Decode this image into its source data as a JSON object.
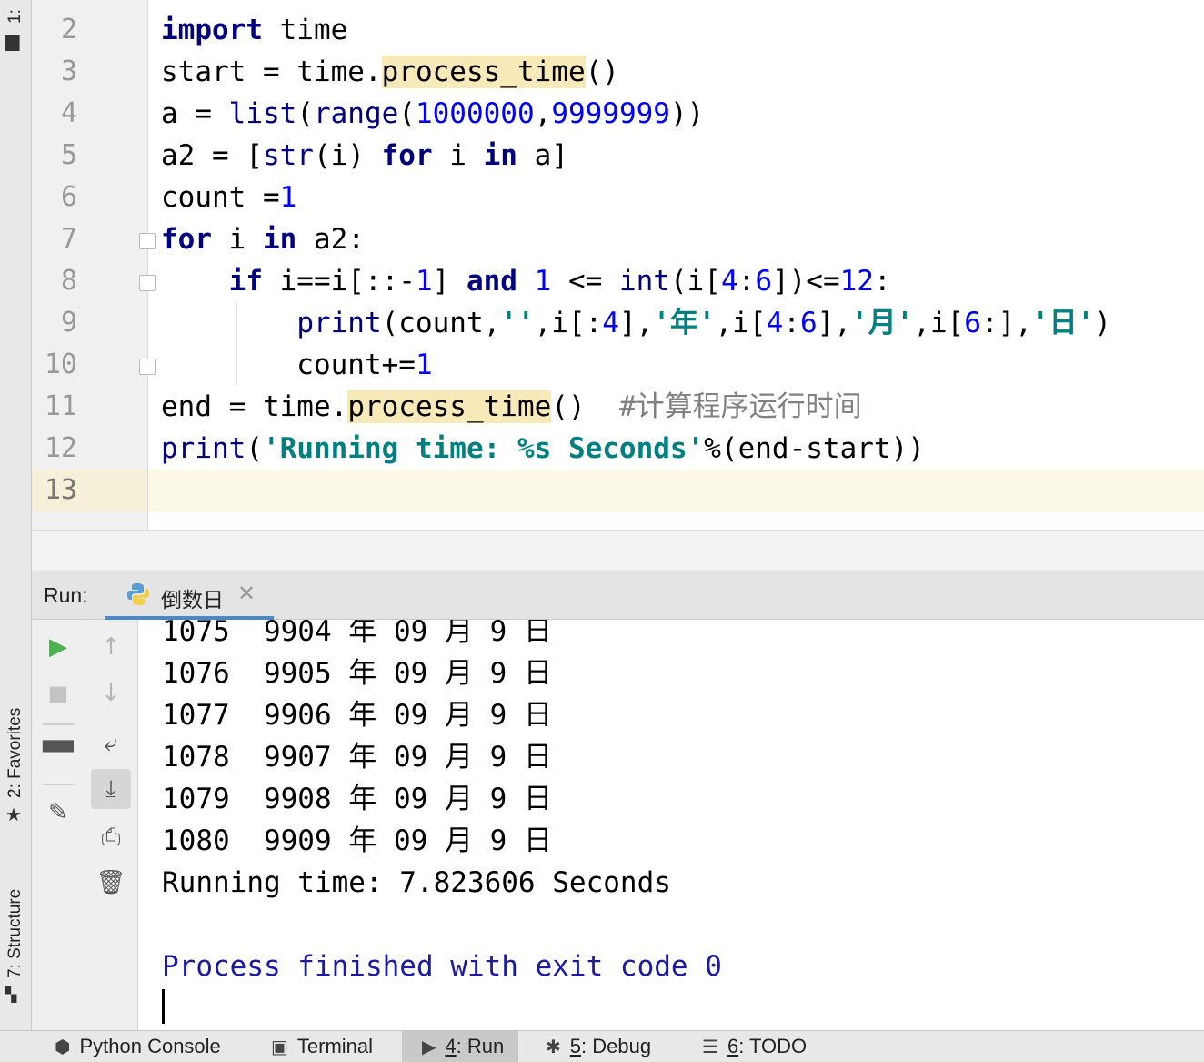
{
  "left_strip": {
    "project_tab": "1:",
    "favorites_tab": "2: Favorites",
    "structure_tab": "7: Structure"
  },
  "editor": {
    "line_numbers": [
      "2",
      "3",
      "4",
      "5",
      "6",
      "7",
      "8",
      "9",
      "10",
      "11",
      "12",
      "13"
    ],
    "comment_text": "#计算程序运行时间"
  },
  "run_panel": {
    "label": "Run:",
    "tab_title": "倒数日",
    "output_lines": [
      "1075  9904 年 09 月 9 日",
      "1076  9905 年 09 月 9 日",
      "1077  9906 年 09 月 9 日",
      "1078  9907 年 09 月 9 日",
      "1079  9908 年 09 月 9 日",
      "1080  9909 年 09 月 9 日",
      "Running time: 7.823606 Seconds",
      "",
      "Process finished with exit code 0"
    ]
  },
  "bottom_bar": {
    "python_console": "Python Console",
    "terminal": "Terminal",
    "run_num": "4",
    "run_label": ": Run",
    "debug_num": "5",
    "debug_label": ": Debug",
    "todo_num": "6",
    "todo_label": ": TODO"
  },
  "colors": {
    "keyword": "#000080",
    "number": "#0000ff",
    "string": "#008080",
    "comment": "#808080",
    "highlight": "#f8eab8",
    "tab_underline": "#4a88c7"
  }
}
